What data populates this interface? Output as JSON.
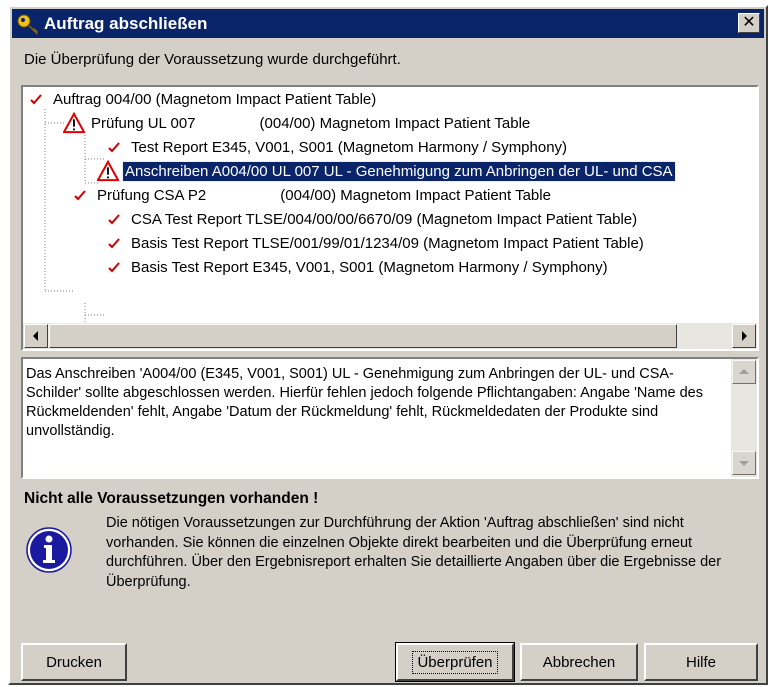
{
  "window": {
    "title": "Auftrag abschließen",
    "close_label": "✕",
    "title_icon": "key-icon"
  },
  "status_line": "Die Überprüfung der Voraussetzung wurde durchgeführt.",
  "tree": {
    "items": [
      {
        "icon": "check-icon",
        "label": "Auftrag 004/00 (Magnetom Impact  Patient Table)",
        "detail": "",
        "selected": false
      },
      {
        "icon": "warning-icon",
        "label": "Prüfung UL 007",
        "detail": "(004/00) Magnetom Impact  Patient Table",
        "selected": false
      },
      {
        "icon": "check-icon",
        "label": "Test Report E345, V001, S001 (Magnetom Harmony / Symphony)",
        "detail": "",
        "selected": false
      },
      {
        "icon": "warning-icon",
        "label": "Anschreiben A004/00 UL 007 UL - Genehmigung zum Anbringen der UL- und CSA",
        "detail": "",
        "selected": true
      },
      {
        "icon": "check-icon",
        "label": "Prüfung CSA P2",
        "detail": "(004/00) Magnetom Impact  Patient Table",
        "selected": false
      },
      {
        "icon": "check-icon",
        "label": "CSA Test Report TLSE/004/00/00/6670/09 (Magnetom Impact  Patient Table)",
        "detail": "",
        "selected": false
      },
      {
        "icon": "check-icon",
        "label": "Basis Test Report TLSE/001/99/01/1234/09 (Magnetom Impact  Patient Table)",
        "detail": "",
        "selected": false
      },
      {
        "icon": "check-icon",
        "label": "Basis Test Report E345, V001, S001 (Magnetom Harmony / Symphony)",
        "detail": "",
        "selected": false
      }
    ]
  },
  "message": "Das Anschreiben 'A004/00 (E345, V001, S001) UL - Genehmigung zum Anbringen der UL- und CSA-Schilder' sollte abgeschlossen werden. Hierfür fehlen jedoch folgende Pflichtangaben: Angabe 'Name des Rückmeldenden' fehlt, Angabe 'Datum der Rückmeldung' fehlt, Rückmeldedaten der Produkte sind unvollständig.",
  "warning": {
    "heading": "Nicht alle Voraussetzungen vorhanden !",
    "text": "Die nötigen Voraussetzungen zur Durchführung der Aktion 'Auftrag abschließen' sind nicht vorhanden. Sie können die einzelnen Objekte direkt bearbeiten und die Überprüfung erneut durchführen. Über den Ergebnisreport erhalten Sie detaillierte Angaben über die Ergebnisse der Überprüfung.",
    "icon": "info-icon"
  },
  "buttons": {
    "print": "Drucken",
    "check": "Überprüfen",
    "cancel": "Abbrechen",
    "help": "Hilfe"
  },
  "colors": {
    "titlebar": "#0a246a",
    "selection": "#0a246a",
    "check": "#cc0000",
    "warning_border": "#e00000",
    "info": "#1a1aa0"
  }
}
